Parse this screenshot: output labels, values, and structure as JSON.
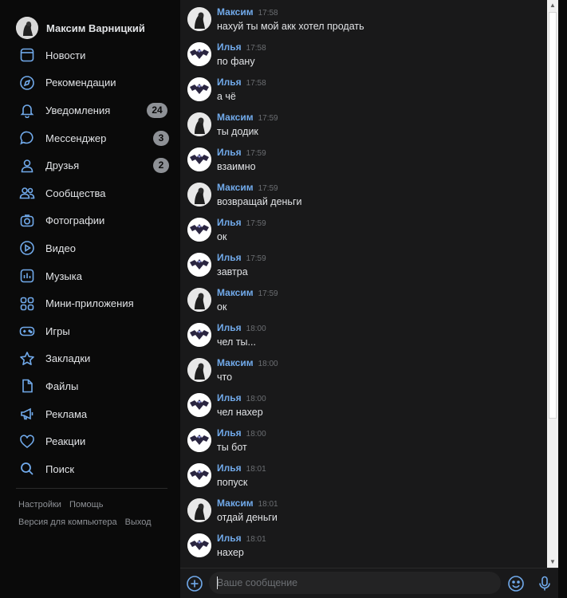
{
  "profile": {
    "name": "Максим Варницкий"
  },
  "nav": [
    {
      "label": "Новости",
      "icon": "news-icon"
    },
    {
      "label": "Рекомендации",
      "icon": "compass-icon"
    },
    {
      "label": "Уведомления",
      "icon": "bell-icon",
      "badge": "24"
    },
    {
      "label": "Мессенджер",
      "icon": "message-icon",
      "badge": "3"
    },
    {
      "label": "Друзья",
      "icon": "user-icon",
      "badge": "2"
    },
    {
      "label": "Сообщества",
      "icon": "users-icon"
    },
    {
      "label": "Фотографии",
      "icon": "camera-icon"
    },
    {
      "label": "Видео",
      "icon": "play-icon"
    },
    {
      "label": "Музыка",
      "icon": "music-icon"
    },
    {
      "label": "Мини-приложения",
      "icon": "apps-icon"
    },
    {
      "label": "Игры",
      "icon": "gamepad-icon"
    },
    {
      "label": "Закладки",
      "icon": "star-icon"
    },
    {
      "label": "Файлы",
      "icon": "file-icon"
    },
    {
      "label": "Реклама",
      "icon": "megaphone-icon"
    },
    {
      "label": "Реакции",
      "icon": "heart-icon"
    },
    {
      "label": "Поиск",
      "icon": "search-icon"
    }
  ],
  "footer": {
    "settings": "Настройки",
    "help": "Помощь",
    "desktop": "Версия для компьютера",
    "logout": "Выход"
  },
  "messages": [
    {
      "author": "Максим",
      "time": "17:58",
      "text": "нахуй ты мой акк хотел продать",
      "who": "maxim"
    },
    {
      "author": "Илья",
      "time": "17:58",
      "text": "по фану",
      "who": "ilya"
    },
    {
      "author": "Илья",
      "time": "17:58",
      "text": "а чё",
      "who": "ilya"
    },
    {
      "author": "Максим",
      "time": "17:59",
      "text": "ты додик",
      "who": "maxim"
    },
    {
      "author": "Илья",
      "time": "17:59",
      "text": "взаимно",
      "who": "ilya"
    },
    {
      "author": "Максим",
      "time": "17:59",
      "text": "возвращай деньги",
      "who": "maxim"
    },
    {
      "author": "Илья",
      "time": "17:59",
      "text": "ок",
      "who": "ilya"
    },
    {
      "author": "Илья",
      "time": "17:59",
      "text": "завтра",
      "who": "ilya"
    },
    {
      "author": "Максим",
      "time": "17:59",
      "text": "ок",
      "who": "maxim"
    },
    {
      "author": "Илья",
      "time": "18:00",
      "text": "чел ты...",
      "who": "ilya"
    },
    {
      "author": "Максим",
      "time": "18:00",
      "text": "что",
      "who": "maxim"
    },
    {
      "author": "Илья",
      "time": "18:00",
      "text": "чел нахер",
      "who": "ilya"
    },
    {
      "author": "Илья",
      "time": "18:00",
      "text": "ты бот",
      "who": "ilya"
    },
    {
      "author": "Илья",
      "time": "18:01",
      "text": "попуск",
      "who": "ilya"
    },
    {
      "author": "Максим",
      "time": "18:01",
      "text": "отдай деньги",
      "who": "maxim"
    },
    {
      "author": "Илья",
      "time": "18:01",
      "text": "нахер",
      "who": "ilya"
    }
  ],
  "composer": {
    "placeholder": "Ваше сообщение"
  },
  "colors": {
    "accent": "#71aaeb",
    "background": "#0a0a0a",
    "chat_background": "#19191a",
    "badge": "#8e9196"
  }
}
